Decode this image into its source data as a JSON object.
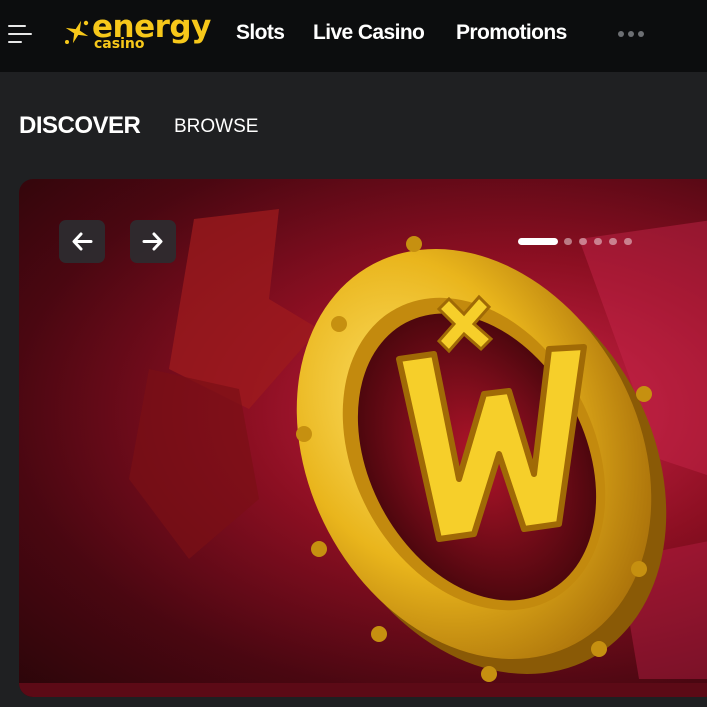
{
  "header": {
    "logo": {
      "word": "energy",
      "sub": "casino"
    },
    "nav": [
      {
        "label": "Slots"
      },
      {
        "label": "Live Casino"
      },
      {
        "label": "Promotions"
      }
    ],
    "menu_icon": "hamburger-menu-icon",
    "more_icon": "more-dots-icon"
  },
  "tabs": {
    "discover": "DISCOVER",
    "browse": "BROWSE"
  },
  "carousel": {
    "slide_count": 6,
    "active_index": 0,
    "prev_icon": "arrow-left-icon",
    "next_icon": "arrow-right-icon"
  },
  "colors": {
    "brand_yellow": "#f7c81a",
    "header_bg": "#0c0d0e",
    "page_bg": "#1f2022",
    "banner_red": "#8c0f22"
  }
}
